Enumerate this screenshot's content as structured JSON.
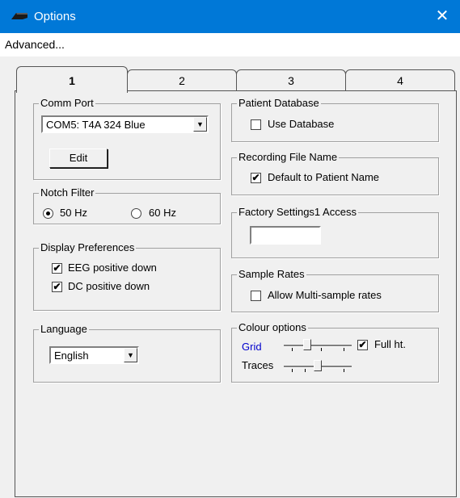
{
  "window": {
    "title": "Options",
    "close_glyph": "✕",
    "title_icon": "app-icon",
    "accent_color": "#0078d7"
  },
  "menu": {
    "advanced_label": "Advanced..."
  },
  "tabs": [
    {
      "label": "1",
      "active": true
    },
    {
      "label": "2",
      "active": false
    },
    {
      "label": "3",
      "active": false
    },
    {
      "label": "4",
      "active": false
    }
  ],
  "comm_port": {
    "legend": "Comm Port",
    "selected": "COM5: T4A 324 Blue",
    "edit_label": "Edit"
  },
  "notch_filter": {
    "legend": "Notch Filter",
    "options": [
      "50 Hz",
      "60 Hz"
    ],
    "selected": "50 Hz"
  },
  "display_prefs": {
    "legend": "Display Preferences",
    "items": [
      {
        "label": "EEG positive down",
        "checked": true
      },
      {
        "label": "DC positive down",
        "checked": true
      }
    ]
  },
  "language": {
    "legend": "Language",
    "selected": "English"
  },
  "patient_db": {
    "legend": "Patient Database",
    "label": "Use Database",
    "checked": false
  },
  "recording_file": {
    "legend": "Recording File Name",
    "label": "Default to Patient Name",
    "checked": true
  },
  "factory": {
    "legend": "Factory Settings1 Access",
    "value": ""
  },
  "sample_rates": {
    "legend": "Sample Rates",
    "label": "Allow Multi-sample rates",
    "checked": false
  },
  "colour": {
    "legend": "Colour options",
    "grid_label": "Grid",
    "grid_color": "#0000cc",
    "traces_label": "Traces",
    "full_ht_label": "Full ht.",
    "full_ht_checked": true,
    "grid_level": 0.33,
    "traces_level": 0.5
  },
  "check_mark": "✔"
}
